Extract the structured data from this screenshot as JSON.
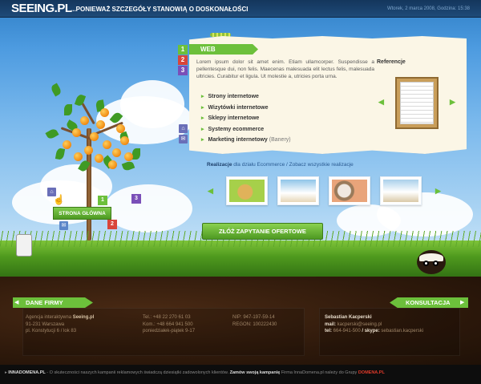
{
  "header": {
    "logo": "SEEING.PL",
    "slogan": "...PONIEWAŻ SZCZEGÓŁY STANOWIĄ O DOSKONAŁOŚCI",
    "datetime": "Wtorek, 2 marca 2008, Godzina: 15:38"
  },
  "panel": {
    "section_label": "WEB",
    "tab_numbers": [
      "1",
      "2",
      "3"
    ],
    "lorem": "Lorem ipsum dolor sit amet enim. Etiam ullamcorper. Suspendisse a pellentesque dui, non felis. Maecenas malesuada elit lectus felis, malesuada ultricies. Curabitur et ligula. Ut molestie a, utricies porta urna.",
    "services": [
      {
        "label": "Strony internetowe",
        "suffix": ""
      },
      {
        "label": "Wizytówki internetowe",
        "suffix": ""
      },
      {
        "label": "Sklepy internetowe",
        "suffix": ""
      },
      {
        "label": "Systemy ecommerce",
        "suffix": ""
      },
      {
        "label": "Marketing internetowy",
        "suffix": "(Banery)"
      }
    ],
    "referencje_title": "Referencje"
  },
  "realizacje": {
    "prefix": "Realizacje",
    "text": " dla działu Ecommerce / Zobacz wszystkie realizacje",
    "thumb_colors": [
      "#9fd14a",
      "#d9a27a",
      "#c48a5a",
      "#7aa8c8"
    ]
  },
  "cta": {
    "label": "ZŁÓŻ ZAPYTANIE OFERTOWE"
  },
  "tree": {
    "home_label": "STRONA GŁÓWNA",
    "tab_numbers": [
      "1",
      "2",
      "3"
    ]
  },
  "footer": {
    "firm_label": "DANE FIRMY",
    "consult_label": "KONSULTACJA",
    "company_col": [
      "Agencja interaktywna ",
      "Seeing.pl",
      "91-231 Warszawa",
      "pl. Konstytucji 6 / lok 83"
    ],
    "phone_col": [
      "Tel.: +48 22 270 61 03",
      "Kom.: +48 664 941 500",
      "poniedziałek-piątek 9-17"
    ],
    "nip_col": [
      "NIP: 947-197-59-14",
      "REGON: 100222430"
    ],
    "consult_col": {
      "name": "Sebastian Kacperski",
      "mail_label": "mail: ",
      "mail": "kacperski@seeing.pl",
      "tel_label": "tel: ",
      "tel": "664-941-500",
      "skype_label": " / skype: ",
      "skype": "sebastian.kacperski"
    }
  },
  "bottombar": {
    "brand": "INNADOMENA.PL",
    "text": " - O skuteczności naszych kampanii reklamowych świadczą dziesiątki zadowolonych klientów. ",
    "cta": "Zamów swoją kampanię",
    "text2": " Firma InnaDomena.pl należy do Grupy ",
    "group": "DOMENA.PL"
  },
  "colors": {
    "accent_green": "#6cc03b",
    "header_navy": "#1e4a78",
    "tab_red": "#d9453a",
    "tab_purple": "#7a4fb8"
  }
}
